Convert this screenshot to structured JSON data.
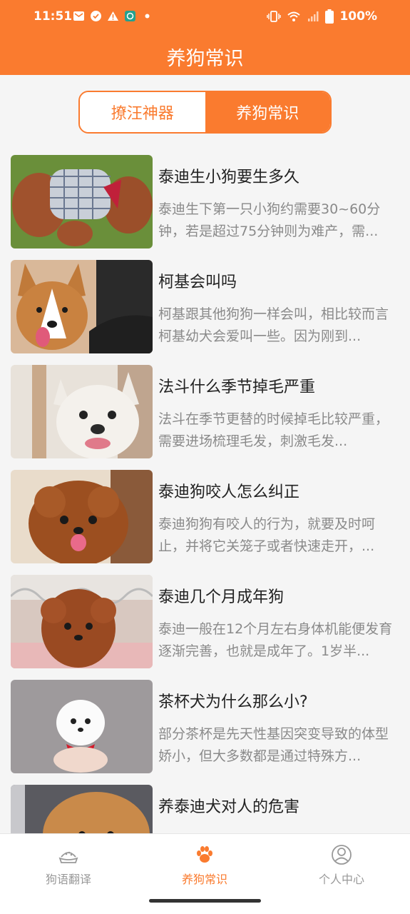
{
  "status_bar": {
    "time": "11:51",
    "battery": "100%"
  },
  "app_bar": {
    "title": "养狗常识"
  },
  "segment": {
    "left_label": "撩汪神器",
    "right_label": "养狗常识"
  },
  "articles": [
    {
      "title": "泰迪生小狗要生多久",
      "desc": "泰迪生下第一只小狗约需要30~60分钟，若是超过75分钟则为难产，需..."
    },
    {
      "title": "柯基会叫吗",
      "desc": "柯基跟其他狗狗一样会叫，相比较而言柯基幼犬会爱叫一些。因为刚到..."
    },
    {
      "title": "法斗什么季节掉毛严重",
      "desc": "法斗在季节更替的时候掉毛比较严重，需要进场梳理毛发，刺激毛发..."
    },
    {
      "title": "泰迪狗咬人怎么纠正",
      "desc": "泰迪狗狗有咬人的行为，就要及时呵止，并将它关笼子或者快速走开，..."
    },
    {
      "title": "泰迪几个月成年狗",
      "desc": "泰迪一般在12个月左右身体机能便发育逐渐完善，也就是成年了。1岁半..."
    },
    {
      "title": "茶杯犬为什么那么小?",
      "desc": "部分茶杯是先天性基因突变导致的体型娇小，但大多数都是通过特殊方..."
    },
    {
      "title": "养泰迪犬对人的危害",
      "desc": ""
    }
  ],
  "bottom_nav": [
    {
      "label": "狗语翻译",
      "icon": "dog-bowl-icon"
    },
    {
      "label": "养狗常识",
      "icon": "paw-icon"
    },
    {
      "label": "个人中心",
      "icon": "person-icon"
    }
  ],
  "colors": {
    "accent": "#fa7b2f",
    "inactive": "#999999"
  }
}
